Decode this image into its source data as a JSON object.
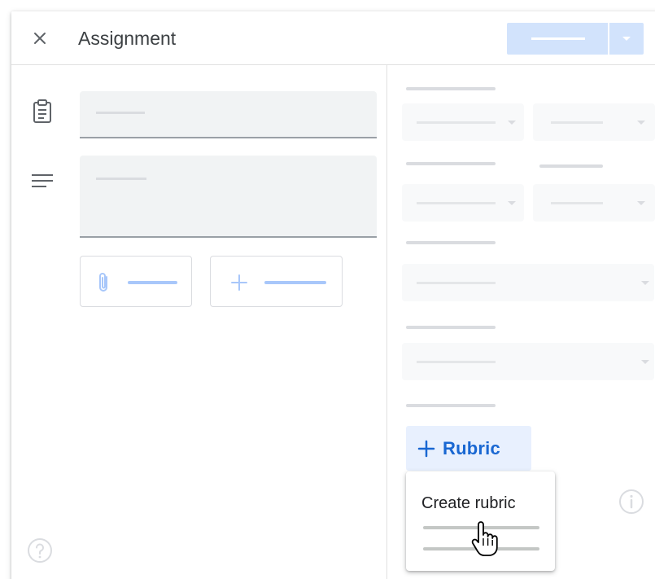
{
  "dialog": {
    "title": "Assignment",
    "close_icon": "close-icon"
  },
  "left_panel": {
    "title_icon": "clipboard-icon",
    "instructions_icon": "notes-lines-icon",
    "add_file_icon": "paperclip-icon",
    "create_icon": "plus-icon",
    "help_icon": "help-circle-icon"
  },
  "right_panel": {
    "rubric_button": {
      "icon": "plus-icon",
      "label": "Rubric"
    },
    "info_icon": "info-icon"
  },
  "rubric_menu": {
    "items": [
      {
        "label": "Create rubric"
      }
    ]
  },
  "colors": {
    "accent": "#1967d2",
    "accent_light": "#d2e3fc",
    "placeholder": "#dadce0"
  }
}
